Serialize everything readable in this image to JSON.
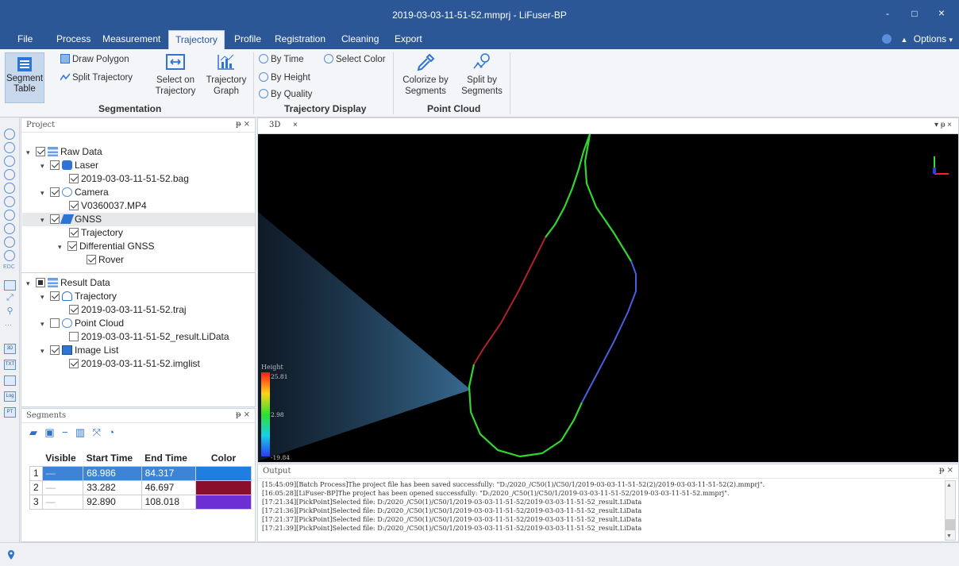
{
  "window": {
    "title": "2019-03-03-11-51-52.mmprj - LiFuser-BP",
    "minimize": "-",
    "maximize": "□",
    "close": "×"
  },
  "menu": {
    "items": [
      "File",
      "Process",
      "Measurement",
      "Trajectory",
      "Profile",
      "Registration",
      "Cleaning",
      "Export"
    ],
    "active": "Trajectory",
    "options": "Options"
  },
  "ribbon": {
    "segmentation": {
      "title": "Segmentation",
      "segment_table": "Segment Table",
      "draw_polygon": "Draw Polygon",
      "split_trajectory": "Split Trajectory",
      "select_on_trajectory": "Select on Trajectory",
      "trajectory_graph": "Trajectory Graph"
    },
    "trajectory_display": {
      "title": "Trajectory Display",
      "by_time": "By Time",
      "select_color": "Select Color",
      "by_height": "By Height",
      "by_quality": "By Quality"
    },
    "point_cloud": {
      "title": "Point Cloud",
      "colorize": "Colorize by Segments",
      "split": "Split by Segments"
    }
  },
  "project_panel": {
    "title": "Project",
    "raw_data": {
      "label": "Raw Data",
      "laser": "Laser",
      "bag_file": "2019-03-03-11-51-52.bag",
      "camera": "Camera",
      "mp4_file": "V0360037.MP4",
      "gnss": "GNSS",
      "trajectory": "Trajectory",
      "differential_gnss": "Differential GNSS",
      "rover": "Rover"
    },
    "result_data": {
      "label": "Result Data",
      "trajectory": "Trajectory",
      "traj_file": "2019-03-03-11-51-52.traj",
      "point_cloud": "Point Cloud",
      "lidata_file": "2019-03-03-11-51-52_result.LiData",
      "image_list": "Image List",
      "imglist_file": "2019-03-03-11-51-52.imglist"
    }
  },
  "segments_panel": {
    "title": "Segments",
    "columns": [
      "Visible",
      "Start Time",
      "End Time",
      "Color"
    ],
    "rows": [
      {
        "index": "1",
        "visible": "—",
        "start": "68.986",
        "end": "84.317",
        "color": "#1f7fe0"
      },
      {
        "index": "2",
        "visible": "—",
        "start": "33.282",
        "end": "46.697",
        "color": "#8a0f2c"
      },
      {
        "index": "3",
        "visible": "—",
        "start": "92.890",
        "end": "108.018",
        "color": "#6c2fd3"
      }
    ]
  },
  "viewport": {
    "tab": "3D",
    "tab_close": "×",
    "legend": {
      "title": "Height",
      "max": "25.81",
      "mid": "2.98",
      "min": "-19.84"
    }
  },
  "output_panel": {
    "title": "Output",
    "lines": [
      "[15:45:09][Batch Process]The project file has been saved successfully: \"D:/2020_/C50(1)/C50/1/2019-03-03-11-51-52(2)/2019-03-03-11-51-52(2).mmprj\".",
      "[16:05:28][LiFuser-BP]The project has been opened successfully: \"D:/2020_/C50(1)/C50/1/2019-03-03-11-51-52/2019-03-03-11-51-52.mmprj\".",
      "[17:21:34][PickPoint]Selected file: D:/2020_/C50(1)/C50/1/2019-03-03-11-51-52/2019-03-03-11-51-52_result.LiData",
      "[17:21:36][PickPoint]Selected file: D:/2020_/C50(1)/C50/1/2019-03-03-11-51-52/2019-03-03-11-51-52_result.LiData",
      "[17:21:37][PickPoint]Selected file: D:/2020_/C50(1)/C50/1/2019-03-03-11-51-52/2019-03-03-11-51-52_result.LiData",
      "[17:21:39][PickPoint]Selected file: D:/2020_/C50(1)/C50/1/2019-03-03-11-51-52/2019-03-03-11-51-52_result.LiData"
    ]
  },
  "lefttool": {
    "edc_label": "EDC",
    "txt_label": "TXT",
    "log_label": "Log",
    "pt_label": "PT",
    "3d_label": "3D"
  },
  "colors": {
    "titlebar": "#2b5797",
    "accent": "#3d84d6",
    "trajectory_green": "#32d62e",
    "trajectory_red": "#b0202f",
    "trajectory_blue": "#4a5fe0"
  }
}
